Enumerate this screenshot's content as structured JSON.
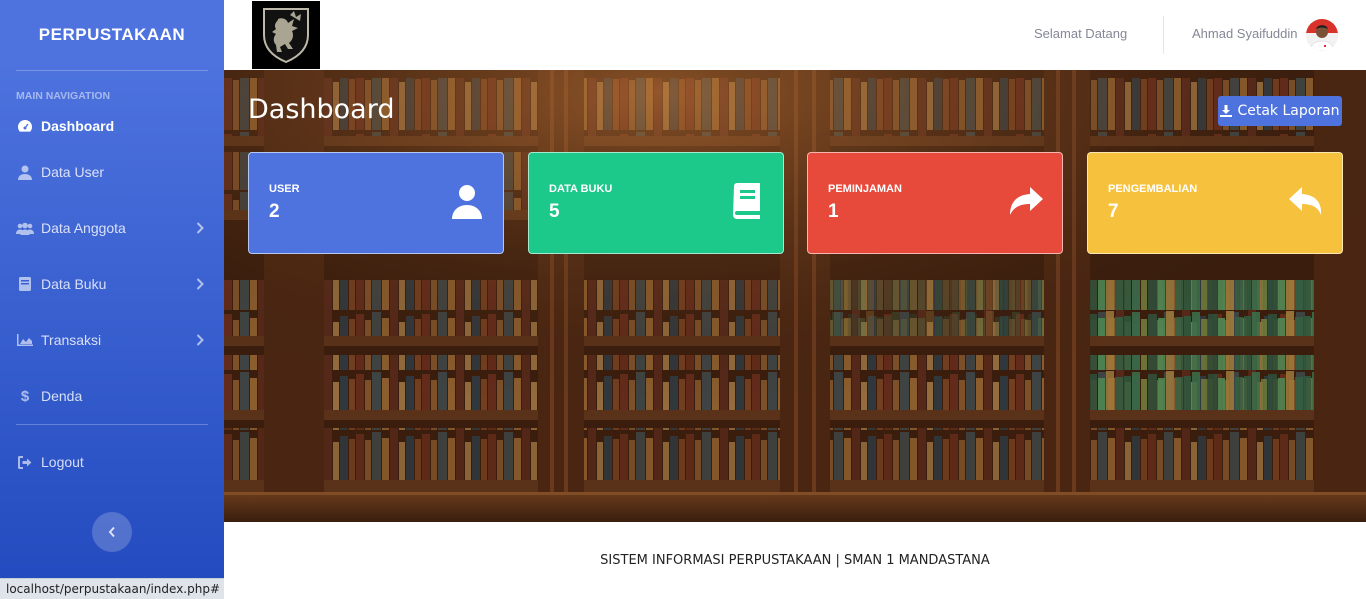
{
  "sidebar": {
    "brand": "PERPUSTAKAAN",
    "heading": "MAIN NAVIGATION",
    "items": [
      {
        "label": "Dashboard",
        "icon": "tachometer-icon",
        "active": true
      },
      {
        "label": "Data User",
        "icon": "user-icon"
      },
      {
        "label": "Data Anggota",
        "icon": "users-icon",
        "has_submenu": true
      },
      {
        "label": "Data Buku",
        "icon": "book-icon",
        "has_submenu": true
      },
      {
        "label": "Transaksi",
        "icon": "chart-area-icon",
        "has_submenu": true
      },
      {
        "label": "Denda",
        "icon": "dollar-icon"
      }
    ],
    "logout_label": "Logout"
  },
  "topbar": {
    "welcome": "Selamat Datang",
    "username": "Ahmad Syaifuddin"
  },
  "main": {
    "title": "Dashboard",
    "report_button": "Cetak Laporan",
    "cards": [
      {
        "label": "USER",
        "value": "2",
        "color": "#4e73df",
        "icon": "user-icon"
      },
      {
        "label": "DATA BUKU",
        "value": "5",
        "color": "#1cc88a",
        "icon": "book-icon"
      },
      {
        "label": "PEMINJAMAN",
        "value": "1",
        "color": "#e74a3b",
        "icon": "share-icon"
      },
      {
        "label": "PENGEMBALIAN",
        "value": "7",
        "color": "#f6c23e",
        "icon": "reply-icon"
      }
    ]
  },
  "footer": {
    "text": "SISTEM INFORMASI PERPUSTAKAAN | SMAN 1 MANDASTANA"
  },
  "status_bar": {
    "url": "localhost/perpustakaan/index.php#"
  }
}
